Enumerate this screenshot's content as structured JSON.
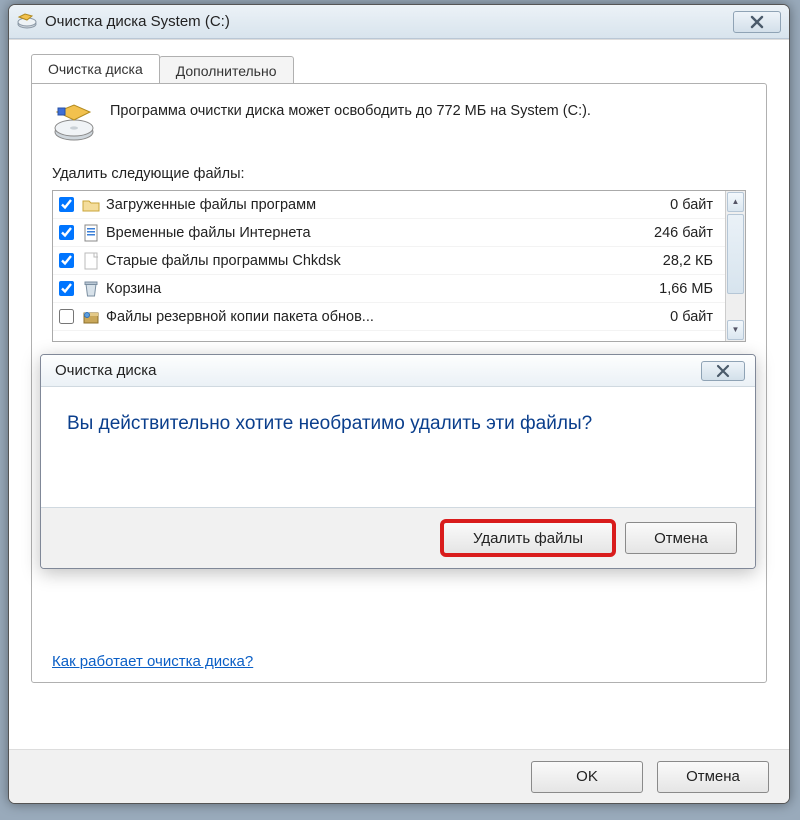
{
  "window": {
    "title": "Очистка диска System (C:)",
    "close_icon": "close"
  },
  "tabs": [
    {
      "label": "Очистка диска",
      "active": true
    },
    {
      "label": "Дополнительно",
      "active": false
    }
  ],
  "description": "Программа очистки диска может освободить до 772 МБ на System (C:).",
  "list_label": "Удалить следующие файлы:",
  "files": [
    {
      "checked": true,
      "icon": "folder",
      "name": "Загруженные файлы программ",
      "size": "0 байт"
    },
    {
      "checked": true,
      "icon": "docblue",
      "name": "Временные файлы Интернета",
      "size": "246 байт"
    },
    {
      "checked": true,
      "icon": "doc",
      "name": "Старые файлы программы Chkdsk",
      "size": "28,2 КБ"
    },
    {
      "checked": true,
      "icon": "bin",
      "name": "Корзина",
      "size": "1,66 МБ"
    },
    {
      "checked": false,
      "icon": "box",
      "name": "Файлы резервной копии пакета обнов...",
      "size": "0 байт"
    }
  ],
  "help_link": "Как работает очистка диска?",
  "main_buttons": {
    "ok": "OK",
    "cancel": "Отмена"
  },
  "confirm": {
    "title": "Очистка диска",
    "message": "Вы действительно хотите необратимо удалить эти файлы?",
    "delete": "Удалить файлы",
    "cancel": "Отмена"
  }
}
